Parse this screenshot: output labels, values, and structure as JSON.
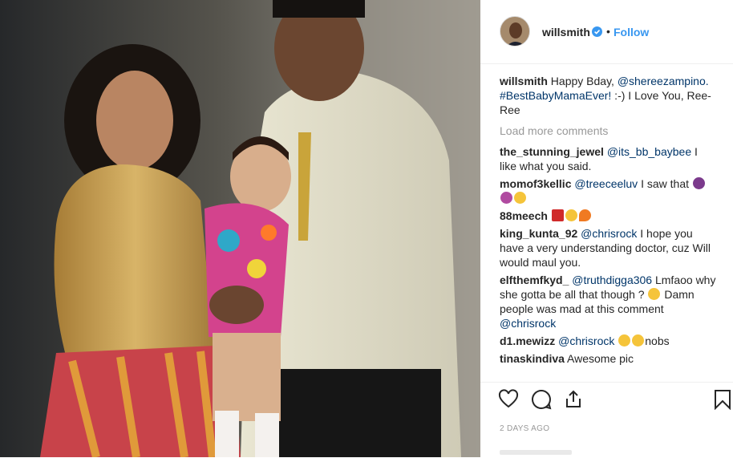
{
  "post": {
    "username": "willsmith",
    "follow_label": "Follow",
    "dot": "•",
    "caption": {
      "user": "willsmith",
      "text_before": "Happy Bday, ",
      "mention": "@shereezampino.",
      "hashtag": "#BestBabyMamaEver!",
      "text_after": " :-) I Love You, Ree-Ree"
    },
    "load_more": "Load more comments",
    "comments": [
      {
        "user": "the_stunning_jewel",
        "mention": "@its_bb_baybee",
        "text": " I like what you said."
      },
      {
        "user": "momof3kellic",
        "mention": "@treeceeluv",
        "text": " I saw that ",
        "emoji": [
          "facepalm",
          "laugh"
        ]
      },
      {
        "user": "88meech",
        "mention": "",
        "text": "",
        "emoji": [
          "hundred",
          "laugh",
          "fire"
        ]
      },
      {
        "user": "king_kunta_92",
        "mention": "@chrisrock",
        "text": " I hope you have a very understanding doctor, cuz Will would maul you."
      },
      {
        "user": "elfthemfkyd_",
        "mention": "@truthdigga306",
        "text": " Lmfaoo why she gotta be all that though ? ",
        "tail": "Damn people was mad at this comment ",
        "tail_mention": "@chrisrock"
      },
      {
        "user": "d1.mewizz",
        "mention": "@chrisrock",
        "text": "nobs",
        "emoji": [
          "laugh",
          "laugh"
        ]
      },
      {
        "user": "tinaskindiva",
        "mention": "",
        "text": " Awesome pic"
      }
    ],
    "timestamp": "2 DAYS AGO",
    "icons": [
      "heart-icon",
      "comment-icon",
      "share-icon",
      "bookmark-icon"
    ],
    "colors": {
      "link": "#003569",
      "follow": "#3897f0",
      "muted": "#999999",
      "verified": "#3897f0"
    }
  }
}
